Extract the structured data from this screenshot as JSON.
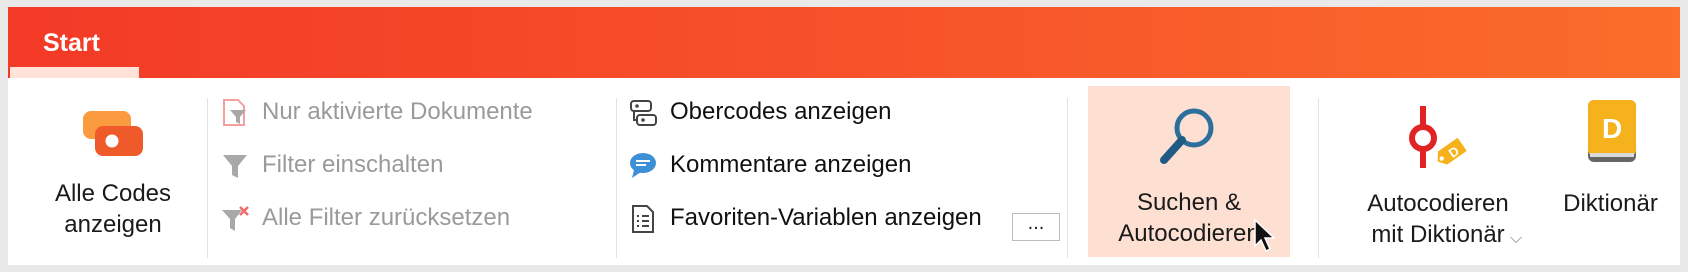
{
  "tabs": [
    {
      "label": "Start",
      "active": true
    }
  ],
  "colors": {
    "accent_start": "#f33a27",
    "accent_end": "#fb6d2a",
    "highlight": "#fde0d2"
  },
  "ribbon": {
    "all_codes": {
      "line1": "Alle Codes",
      "line2": "anzeigen",
      "icon": "codes-icon"
    },
    "filters": [
      {
        "label": "Nur aktivierte Dokumente",
        "icon": "document-filter-icon",
        "enabled": false
      },
      {
        "label": "Filter einschalten",
        "icon": "filter-funnel-icon",
        "enabled": false
      },
      {
        "label": "Alle Filter zurücksetzen",
        "icon": "filter-reset-icon",
        "enabled": false
      }
    ],
    "views": [
      {
        "label": "Obercodes anzeigen",
        "icon": "parent-codes-icon",
        "enabled": true
      },
      {
        "label": "Kommentare anzeigen",
        "icon": "comment-bubble-icon",
        "enabled": true
      },
      {
        "label": "Favoriten-Variablen anzeigen",
        "icon": "variables-list-icon",
        "enabled": true
      }
    ],
    "more_button": "...",
    "search_autocode": {
      "line1": "Suchen &",
      "line2": "Autocodieren",
      "icon": "magnifier-icon"
    },
    "autocode_dictionary": {
      "line1": "Autocodieren",
      "line2": "mit Diktionär",
      "icon": "autocode-tag-icon"
    },
    "dictionary": {
      "label": "Diktionär",
      "icon": "dictionary-book-icon"
    }
  }
}
